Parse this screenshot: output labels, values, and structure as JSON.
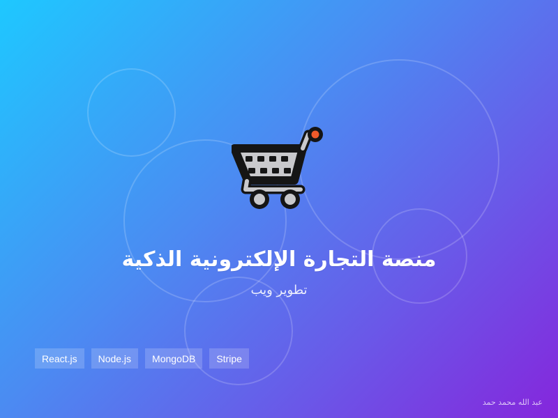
{
  "hero": {
    "icon": "shopping-cart-icon",
    "title": "منصة التجارة الإلكترونية الذكية",
    "subtitle": "تطوير ويب"
  },
  "tech_stack": {
    "items": [
      {
        "label": "React.js"
      },
      {
        "label": "Node.js"
      },
      {
        "label": "MongoDB"
      },
      {
        "label": "Stripe"
      }
    ]
  },
  "footer": {
    "author": "عبد الله محمد حمد"
  },
  "theme": {
    "gradient_start": "#1ec8ff",
    "gradient_middle": "#4b8bf2",
    "gradient_end": "#8526dc",
    "cart_gray": "#c9c9cc",
    "cart_dark": "#151515",
    "cart_accent": "#f05a2a"
  }
}
